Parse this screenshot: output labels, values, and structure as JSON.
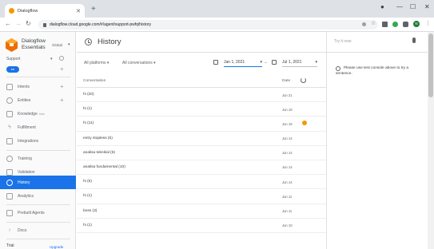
{
  "browser": {
    "tab_title": "Dialogflow",
    "url": "dialogflow.cloud.google.com/#/agent/support-pwfq/history",
    "profile_initial": "N"
  },
  "sidebar": {
    "brand_name": "Dialogflow Essentials",
    "region": "Global",
    "agent": "Support",
    "language": "en",
    "items": [
      {
        "label": "Intents",
        "icon": "chat-bubble-icon",
        "add": true
      },
      {
        "label": "Entities",
        "icon": "entities-icon",
        "add": true
      },
      {
        "label": "Knowledge",
        "badge": "beta",
        "icon": "book-icon"
      },
      {
        "label": "Fulfillment",
        "icon": "bolt-icon"
      },
      {
        "label": "Integrations",
        "icon": "integrations-icon"
      },
      {
        "label": "Training",
        "icon": "training-icon"
      },
      {
        "label": "Validation",
        "icon": "validation-icon"
      },
      {
        "label": "History",
        "icon": "history-icon",
        "active": true
      },
      {
        "label": "Analytics",
        "icon": "analytics-icon"
      },
      {
        "label": "Prebuilt Agents",
        "icon": "prebuilt-icon"
      },
      {
        "label": "Docs",
        "icon": "chevron-right-icon"
      }
    ],
    "trial": "Trial",
    "upgrade": "Upgrade"
  },
  "main": {
    "title": "History",
    "filters": {
      "platforms": "All platforms",
      "conversations": "All conversations",
      "date_from": "Jan 1, 2021",
      "date_separator": "–",
      "date_to": "Jul 1, 2021"
    },
    "table": {
      "col_conversation": "Conversation",
      "col_date": "Date",
      "rows": [
        {
          "conversation": "hi (20)",
          "date": "Jun 21",
          "warning": false
        },
        {
          "conversation": "hi (1)",
          "date": "Jun 18",
          "warning": false
        },
        {
          "conversation": "hi (11)",
          "date": "Jun 18",
          "warning": true
        },
        {
          "conversation": "entry stopless (5)",
          "date": "Jun 14",
          "warning": false
        },
        {
          "conversation": "analisa teknikal (5)",
          "date": "Jun 14",
          "warning": false
        },
        {
          "conversation": "analisa fundamental (10)",
          "date": "Jun 14",
          "warning": false
        },
        {
          "conversation": "hi (5)",
          "date": "Jun 14",
          "warning": false
        },
        {
          "conversation": "hi (1)",
          "date": "Jun 11",
          "warning": false
        },
        {
          "conversation": "boss (3)",
          "date": "Jun 11",
          "warning": false
        },
        {
          "conversation": "hi (1)",
          "date": "Jun 10",
          "warning": false
        }
      ]
    }
  },
  "tryit": {
    "placeholder": "Try it now",
    "info": "Please use test console above to try a sentence."
  },
  "colors": {
    "accent": "#1a73e8",
    "warning": "#f29900"
  }
}
